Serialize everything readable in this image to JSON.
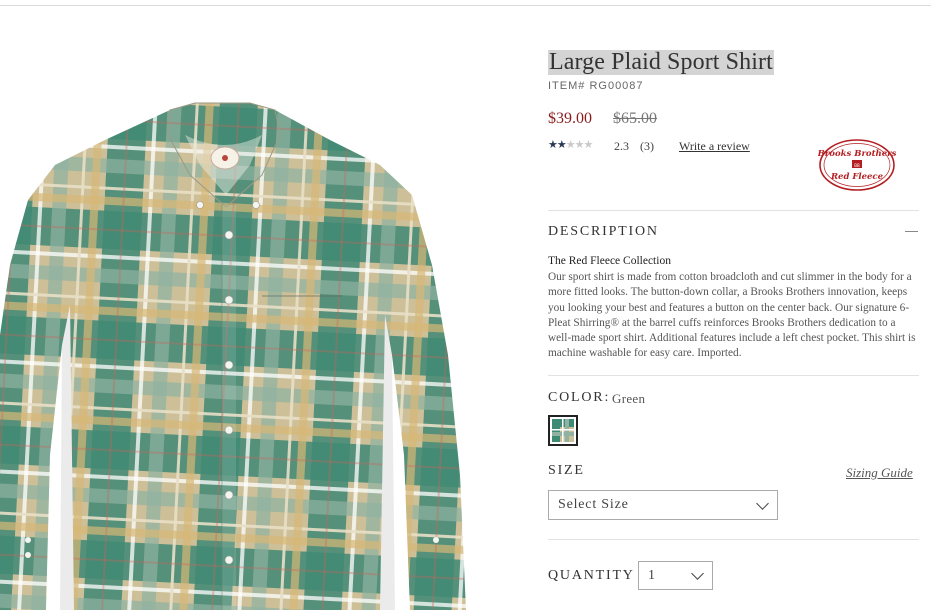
{
  "product": {
    "title": "Large Plaid Sport Shirt",
    "item_number": "ITEM# RG00087",
    "price_current": "$39.00",
    "price_original": "$65.00",
    "rating": 2.3,
    "rating_text": "2.3",
    "review_count": "(3)",
    "write_review_label": "Write a review",
    "brand_badge": "Brooks Brothers Red Fleece"
  },
  "description": {
    "heading": "DESCRIPTION",
    "subheading": "The Red Fleece Collection",
    "body": "Our sport shirt is made from cotton broadcloth and cut slimmer in the body for a more fitted looks. The button-down collar, a Brooks Brothers innovation, keeps you looking your best and features a button on the center back. Our signature 6-Pleat Shirring® at the barrel cuffs reinforces Brooks Brothers dedication to a well-made sport shirt. Additional features include a left chest pocket. This shirt is machine washable for easy care. Imported."
  },
  "color": {
    "label": "COLOR:",
    "selected": "Green"
  },
  "size": {
    "label": "SIZE",
    "guide_label": "Sizing Guide",
    "placeholder": "Select Size"
  },
  "quantity": {
    "label": "QUANTITY",
    "value": "1"
  },
  "colors": {
    "price_accent": "#8b1c1c",
    "shirt_green": "#3f8a74",
    "shirt_tan": "#cdb990"
  }
}
